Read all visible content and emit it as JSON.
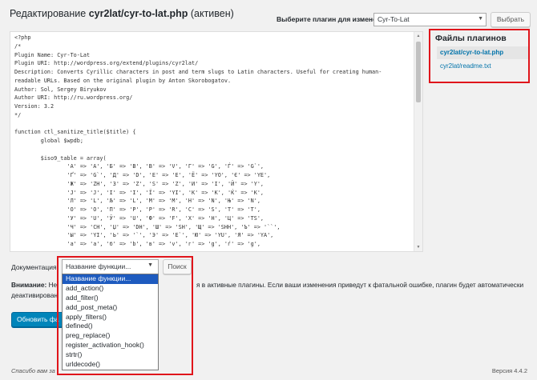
{
  "header": {
    "title_prefix": "Редактирование",
    "title_file": "cyr2lat/cyr-to-lat.php",
    "title_suffix": "(активен)",
    "plugin_select_label": "Выберите плагин для изменения:",
    "plugin_select_value": "Cyr-To-Lat",
    "choose_button": "Выбрать"
  },
  "editor": {
    "code": "<?php\n/*\nPlugin Name: Cyr-To-Lat\nPlugin URI: http://wordpress.org/extend/plugins/cyr2lat/\nDescription: Converts Cyrillic characters in post and term slugs to Latin characters. Useful for creating human-\nreadable URLs. Based on the original plugin by Anton Skorobogatov.\nAuthor: Sol, Sergey Biryukov\nAuthor URI: http://ru.wordpress.org/\nVersion: 3.2\n*/\n\nfunction ctl_sanitize_title($title) {\n        global $wpdb;\n\n        $iso9_table = array(\n                'А' => 'A', 'Б' => 'B', 'В' => 'V', 'Г' => 'G', 'Ѓ' => 'G`',\n                'Ґ' => 'G`', 'Д' => 'D', 'Е' => 'E', 'Ё' => 'YO', 'Є' => 'YE',\n                'Ж' => 'ZH', 'З' => 'Z', 'Ѕ' => 'Z', 'И' => 'I', 'Й' => 'Y',\n                'Ј' => 'J', 'І' => 'I', 'Ї' => 'YI', 'К' => 'K', 'Ќ' => 'K',\n                'Л' => 'L', 'Љ' => 'L', 'М' => 'M', 'Н' => 'N', 'Њ' => 'N',\n                'О' => 'O', 'П' => 'P', 'Р' => 'R', 'С' => 'S', 'Т' => 'T',\n                'У' => 'U', 'Ў' => 'U', 'Ф' => 'F', 'Х' => 'H', 'Ц' => 'TS',\n                'Ч' => 'CH', 'Џ' => 'DH', 'Ш' => 'SH', 'Щ' => 'SHH', 'Ъ' => '``',\n                'Ы' => 'YI', 'Ь' => '`', 'Э' => 'E`', 'Ю' => 'YU', 'Я' => 'YA',\n                'а' => 'a', 'б' => 'b', 'в' => 'v', 'г' => 'g', 'ѓ' => 'g',"
  },
  "plugin_files": {
    "title": "Файлы плагинов",
    "current": "cyr2lat/cyr-to-lat.php",
    "other": "cyr2lat/readme.txt"
  },
  "documentation": {
    "label": "Документация:",
    "select_value": "Название функции...",
    "lookup_button": "Поиск",
    "options": [
      "Название функции...",
      "add_action()",
      "add_filter()",
      "add_post_meta()",
      "apply_filters()",
      "defined()",
      "preg_replace()",
      "register_activation_hook()",
      "strtr()",
      "urldecode()"
    ]
  },
  "notice": {
    "warning_label": "Внимание:",
    "text_part1": "Не",
    "text_part2": "я в активные плагины. Если ваши изменения приведут к фатальной ошибке, плагин будет автоматически",
    "text_part3": "деактивирован"
  },
  "update_button": "Обновить фа",
  "footer": {
    "left": "Спасибо вам за",
    "version": "Версия 4.4.2"
  },
  "colors": {
    "highlight_border": "#e0151b",
    "link": "#0073aa",
    "primary_button": "#0085ba",
    "dropdown_selected": "#1e5bbf"
  }
}
